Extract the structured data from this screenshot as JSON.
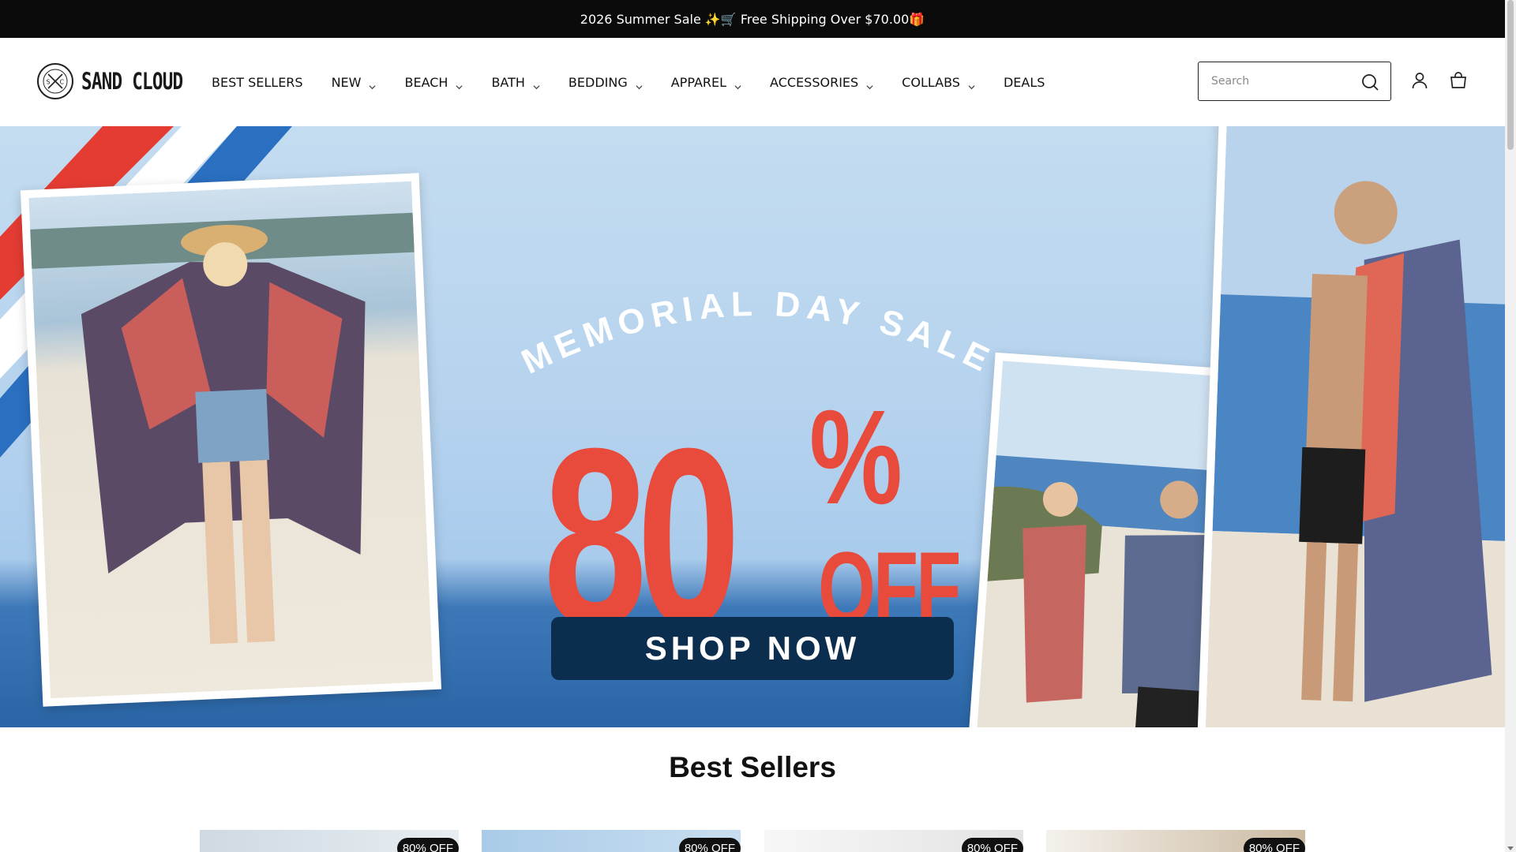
{
  "announcement": {
    "text": "2026 Summer Sale ✨🛒 Free Shipping Over $70.00🎁"
  },
  "brand": {
    "name": "SAND CLOUD",
    "mark_letters": [
      "S",
      "C"
    ]
  },
  "nav": {
    "items": [
      {
        "label": "BEST SELLERS",
        "dropdown": false
      },
      {
        "label": "NEW",
        "dropdown": true
      },
      {
        "label": "BEACH",
        "dropdown": true
      },
      {
        "label": "BATH",
        "dropdown": true
      },
      {
        "label": "BEDDING",
        "dropdown": true
      },
      {
        "label": "APPAREL",
        "dropdown": true
      },
      {
        "label": "ACCESSORIES",
        "dropdown": true
      },
      {
        "label": "COLLABS",
        "dropdown": true
      },
      {
        "label": "DEALS",
        "dropdown": false
      }
    ]
  },
  "search": {
    "placeholder": "Search",
    "value": "",
    "icon": "search-icon"
  },
  "header_icons": {
    "account": "account-icon",
    "cart": "cart-icon"
  },
  "hero": {
    "headline": "MEMORIAL DAY SALE",
    "discount_number": "80",
    "discount_symbol": "%",
    "discount_word": "OFF",
    "cta_label": "SHOP NOW",
    "colors": {
      "accent_red": "#e84a3b",
      "cta_navy": "#0b2d4e",
      "sky": "#b4d2ee"
    }
  },
  "best_sellers": {
    "title": "Best Sellers",
    "cards": [
      {
        "badge": "80% OFF"
      },
      {
        "badge": "80% OFF"
      },
      {
        "badge": "80% OFF"
      },
      {
        "badge": "80% OFF"
      }
    ]
  }
}
